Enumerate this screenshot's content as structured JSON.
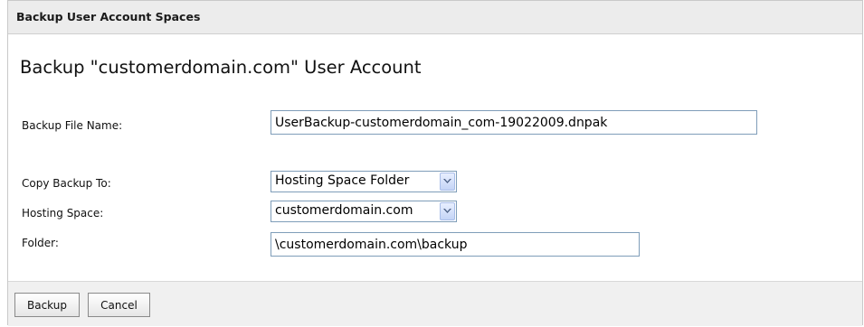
{
  "panel": {
    "header_title": "Backup User Account Spaces"
  },
  "page_title": "Backup \"customerdomain.com\" User Account",
  "form": {
    "backup_file_name": {
      "label": "Backup File Name:",
      "value": "UserBackup-customerdomain_com-19022009.dnpak"
    },
    "copy_backup_to": {
      "label": "Copy Backup To:",
      "selected": "Hosting Space Folder"
    },
    "hosting_space": {
      "label": "Hosting Space:",
      "selected": "customerdomain.com"
    },
    "folder": {
      "label": "Folder:",
      "value": "\\customerdomain.com\\backup"
    }
  },
  "buttons": {
    "backup_label": "Backup",
    "cancel_label": "Cancel"
  },
  "icons": {
    "dropdown": "chevron-down-icon"
  },
  "colors": {
    "header_bg": "#ececec",
    "input_border": "#7f9db9",
    "dropdown_arrow": "#4d6185",
    "footer_bg": "#f0f0f0"
  }
}
